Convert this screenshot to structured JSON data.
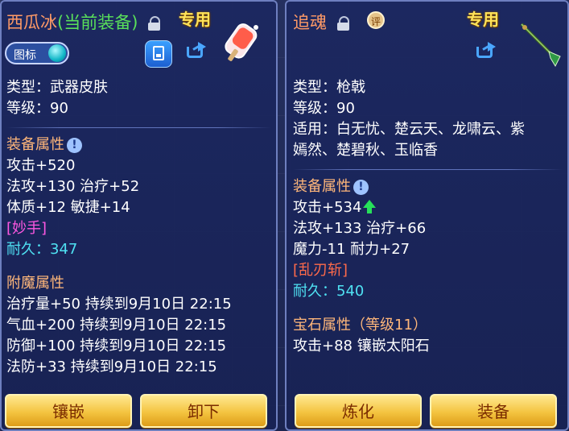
{
  "left_panel": {
    "title_name": "西瓜冰",
    "title_equipped": "(当前装备)",
    "exclusive_label": "专用",
    "toggle_label": "图标",
    "stats": {
      "type": "类型：武器皮肤",
      "level": "等级：90"
    },
    "equip_attr_title": "装备属性",
    "equip_attrs": [
      "攻击+520",
      "法攻+130 治疗+52",
      "体质+12 敏捷+14"
    ],
    "special_skill": "[妙手]",
    "durability_label": "耐久：",
    "durability_value": "347",
    "enchant_title": "附魔属性",
    "enchants": [
      "治疗量+50 持续到9月10日 22:15",
      "气血+200 持续到9月10日 22:15",
      "防御+100 持续到9月10日 22:15",
      "法防+33 持续到9月10日 22:15"
    ],
    "buttons": {
      "inlay": "镶嵌",
      "unequip": "卸下"
    }
  },
  "right_panel": {
    "title_name": "追魂",
    "exclusive_label": "专用",
    "badge_char": "评",
    "stats": {
      "type": "类型：枪戟",
      "level": "等级：90",
      "applicable_1": "适用：白无忧、楚云天、龙啸云、紫",
      "applicable_2": "嫣然、楚碧秋、玉临香"
    },
    "equip_attr_title": "装备属性",
    "attack": "攻击+534",
    "equip_attrs": [
      "法攻+133 治疗+66",
      "魔力-11 耐力+27"
    ],
    "special_skill": "[乱刃斩]",
    "durability_label": "耐久：",
    "durability_value": "540",
    "gem_title": "宝石属性（等级11）",
    "gem_attr": "攻击+88 镶嵌太阳石",
    "buttons": {
      "refine": "炼化",
      "equip": "装备"
    }
  },
  "icons": [
    "lock-icon",
    "save-icon",
    "share-icon",
    "ice-pop-skin-icon",
    "spear-weapon-icon",
    "info-icon",
    "up-arrow-icon"
  ],
  "colors": {
    "panel_bg": "#1b2760",
    "exclusive": "#ffe35a",
    "name": "#ff9a66",
    "equipped": "#59e05a",
    "section": "#ffb77a",
    "skill_pink": "#ff58e2",
    "skill_red": "#ff6a4a",
    "durability": "#4fe1f2",
    "button": "#f4c440"
  }
}
